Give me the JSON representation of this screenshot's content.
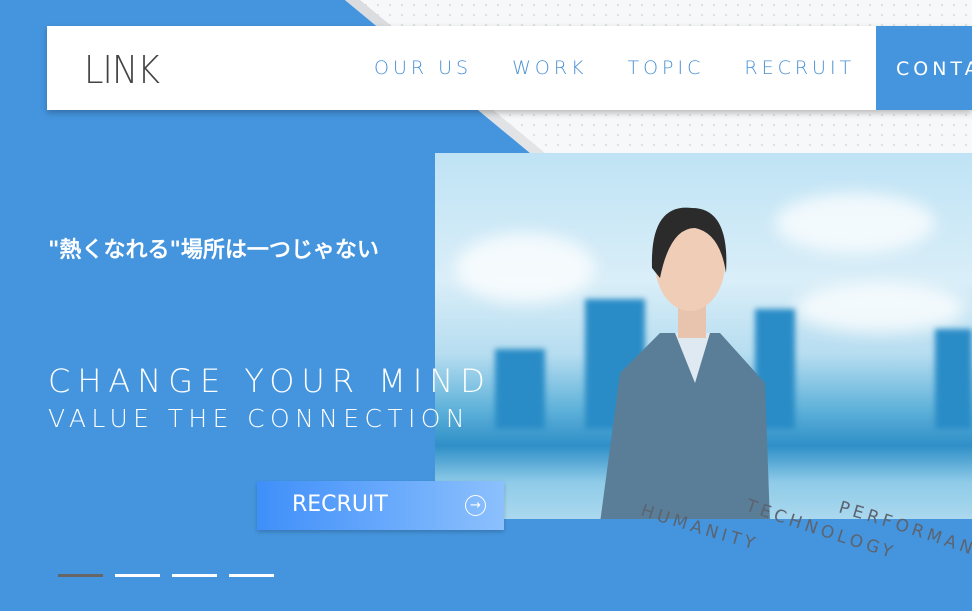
{
  "header": {
    "logo": "LINK",
    "nav": [
      "OUR US",
      "WORK",
      "TOPIC",
      "RECRUIT"
    ],
    "contact": "CONTACT"
  },
  "hero": {
    "catch_jp": "\"熱くなれる\"場所は一つじゃない",
    "headline": "CHANGE YOUR MIND",
    "subheadline": "VALUE THE CONNECTION",
    "button": "RECRUIT",
    "keywords": [
      "HUMANITY",
      "TECHNOLOGY",
      "PERFORMANCE"
    ]
  },
  "slider": {
    "count": 4,
    "active": 1
  },
  "colors": {
    "brand": "#4595de",
    "nav_text": "#4a90d4"
  }
}
